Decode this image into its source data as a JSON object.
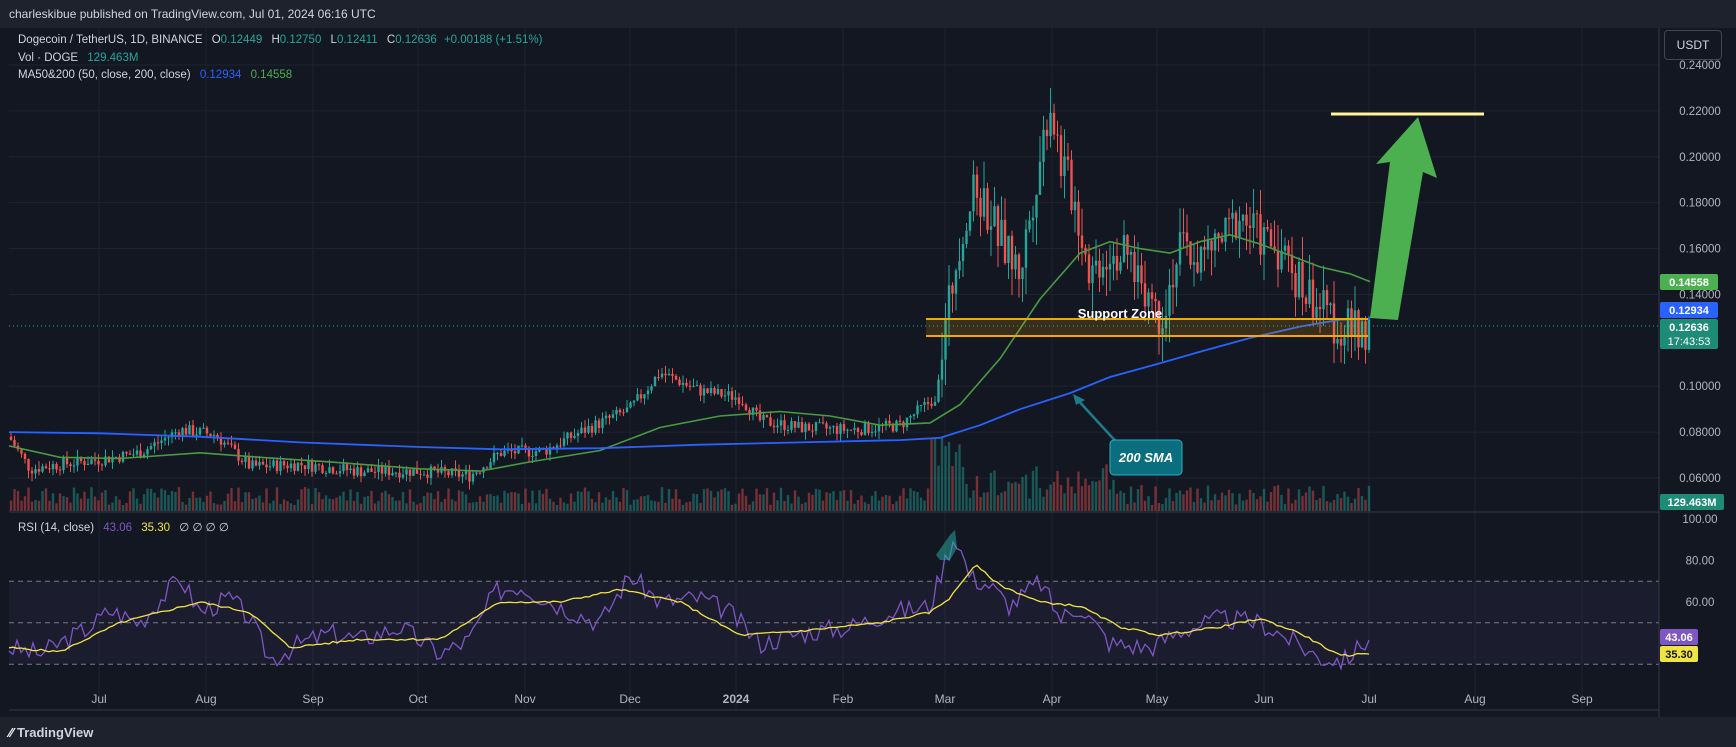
{
  "header": {
    "publisher_line": "charleskibue published on TradingView.com, Jul 01, 2024 06:16 UTC"
  },
  "footer": {
    "brand": "TradingView"
  },
  "symbol": {
    "name": "Dogecoin / TetherUS, 1D, BINANCE",
    "o_label": "O",
    "o": "0.12449",
    "h_label": "H",
    "h": "0.12750",
    "l_label": "L",
    "l": "0.12411",
    "c_label": "C",
    "c": "0.12636",
    "change": "+0.00188 (+1.51%)"
  },
  "volume": {
    "label": "Vol · DOGE",
    "value": "129.463M"
  },
  "ma": {
    "label": "MA50&200 (50, close, 200, close)",
    "ma50": "0.12934",
    "ma200": "0.14558"
  },
  "rsi": {
    "label": "RSI (14, close)",
    "value": "43.06",
    "ma": "35.30",
    "extras": "∅ ∅ ∅ ∅"
  },
  "currency_button": "USDT",
  "annotations": {
    "support_zone": "Support Zone",
    "sma_callout": "200 SMA"
  },
  "price_badges": {
    "ma200": "0.14558",
    "ma50": "0.12934",
    "last": "0.12636",
    "countdown": "17:43:53",
    "volume": "129.463M",
    "rsi": "43.06",
    "rsi_ma": "35.30"
  },
  "colors": {
    "background": "#131722",
    "up": "#26a69a",
    "down": "#ef5350",
    "ma50_line": "#2962ff",
    "ma200_line": "#4caf50",
    "support_zone": "#f7a600",
    "target_line": "#fff59d",
    "arrow": "#4caf50",
    "rsi_line": "#7e57c2",
    "rsi_ma_line": "#f0e443"
  },
  "chart_data": [
    {
      "type": "line",
      "title": "Dogecoin / TetherUS, 1D, BINANCE",
      "x": [
        "2024-06-15",
        "2024-07-01",
        "2024-08-01",
        "2024-09-01",
        "2024-10-01",
        "2024-11-01",
        "2024-12-01",
        "2024-01-01",
        "2024-02-01",
        "2024-03-01",
        "2024-04-01",
        "2024-05-01",
        "2024-06-01",
        "2024-07-01"
      ],
      "x_tick_labels": [
        "Jul",
        "Aug",
        "Sep",
        "Oct",
        "Nov",
        "Dec",
        "2024",
        "Feb",
        "Mar",
        "Apr",
        "May",
        "Jun",
        "Jul",
        "Aug",
        "Sep"
      ],
      "y_tick_labels": [
        "0.24000",
        "0.22000",
        "0.20000",
        "0.18000",
        "0.16000",
        "0.14000",
        "0.10000",
        "0.08000",
        "0.06000"
      ],
      "ylim": [
        0.05,
        0.24
      ],
      "series": [
        {
          "name": "close",
          "values": [
            0.064,
            0.066,
            0.079,
            0.063,
            0.062,
            0.072,
            0.102,
            0.088,
            0.082,
            0.19,
            0.175,
            0.152,
            0.16,
            0.126
          ]
        },
        {
          "name": "MA50",
          "values": [
            0.068,
            0.07,
            0.078,
            0.072,
            0.061,
            0.062,
            0.085,
            0.089,
            0.083,
            0.12,
            0.16,
            0.166,
            0.152,
            0.145
          ]
        },
        {
          "name": "MA200",
          "values": [
            0.08,
            0.079,
            0.077,
            0.074,
            0.073,
            0.072,
            0.073,
            0.075,
            0.076,
            0.079,
            0.098,
            0.108,
            0.118,
            0.129
          ]
        }
      ],
      "support_zone": {
        "low": 0.121,
        "high": 0.128,
        "label": "Support Zone"
      },
      "target_level": 0.218,
      "last_price": 0.12636
    },
    {
      "type": "line",
      "title": "RSI (14, close)",
      "y_tick_labels": [
        "100.00",
        "80.00",
        "60.00"
      ],
      "ylim": [
        20,
        100
      ],
      "bands": [
        30,
        50,
        70
      ],
      "series": [
        {
          "name": "RSI",
          "values": [
            37,
            45,
            55,
            35,
            48,
            72,
            58,
            45,
            58,
            93,
            75,
            30,
            55,
            43.06
          ]
        },
        {
          "name": "RSI MA",
          "values": [
            38,
            40,
            55,
            36,
            45,
            65,
            56,
            45,
            52,
            78,
            72,
            40,
            52,
            35.3
          ]
        }
      ]
    }
  ]
}
